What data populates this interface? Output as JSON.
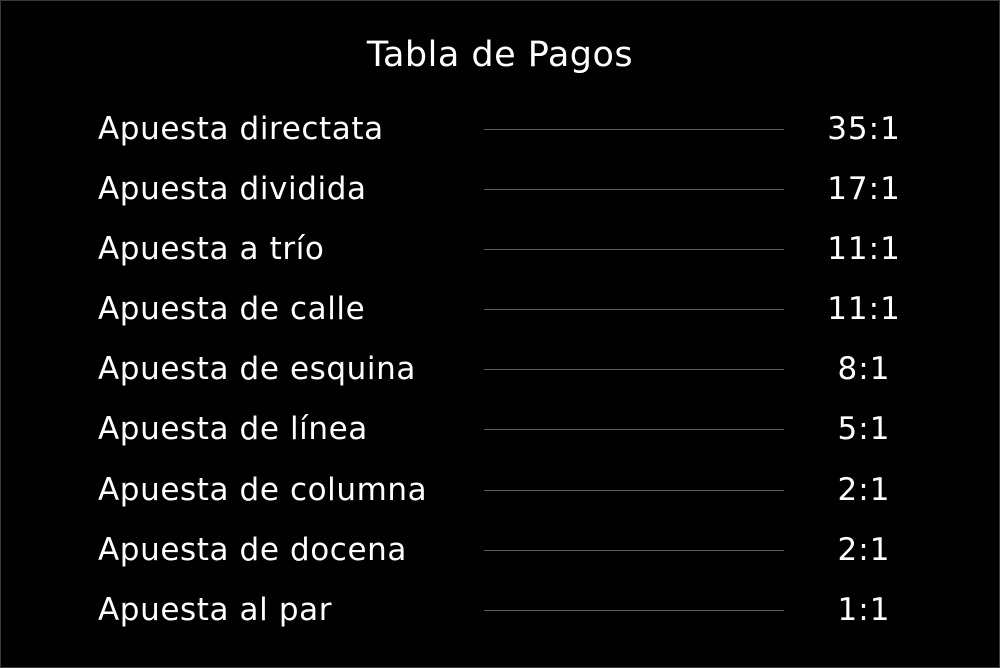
{
  "window": {
    "title": "Tabla de Pagos"
  },
  "payout_table": {
    "rows": [
      {
        "bet": "Apuesta directata",
        "payout": "35:1"
      },
      {
        "bet": "Apuesta dividida",
        "payout": "17:1"
      },
      {
        "bet": "Apuesta a trío",
        "payout": "11:1"
      },
      {
        "bet": "Apuesta de calle",
        "payout": "11:1"
      },
      {
        "bet": "Apuesta de esquina",
        "payout": "8:1"
      },
      {
        "bet": "Apuesta de línea",
        "payout": "5:1"
      },
      {
        "bet": "Apuesta de columna",
        "payout": "2:1"
      },
      {
        "bet": "Apuesta de docena",
        "payout": "2:1"
      },
      {
        "bet": "Apuesta al par",
        "payout": "1:1"
      }
    ]
  },
  "colors": {
    "background": "#000000",
    "text": "#ffffff",
    "leader_line": "#5a5a5a"
  }
}
